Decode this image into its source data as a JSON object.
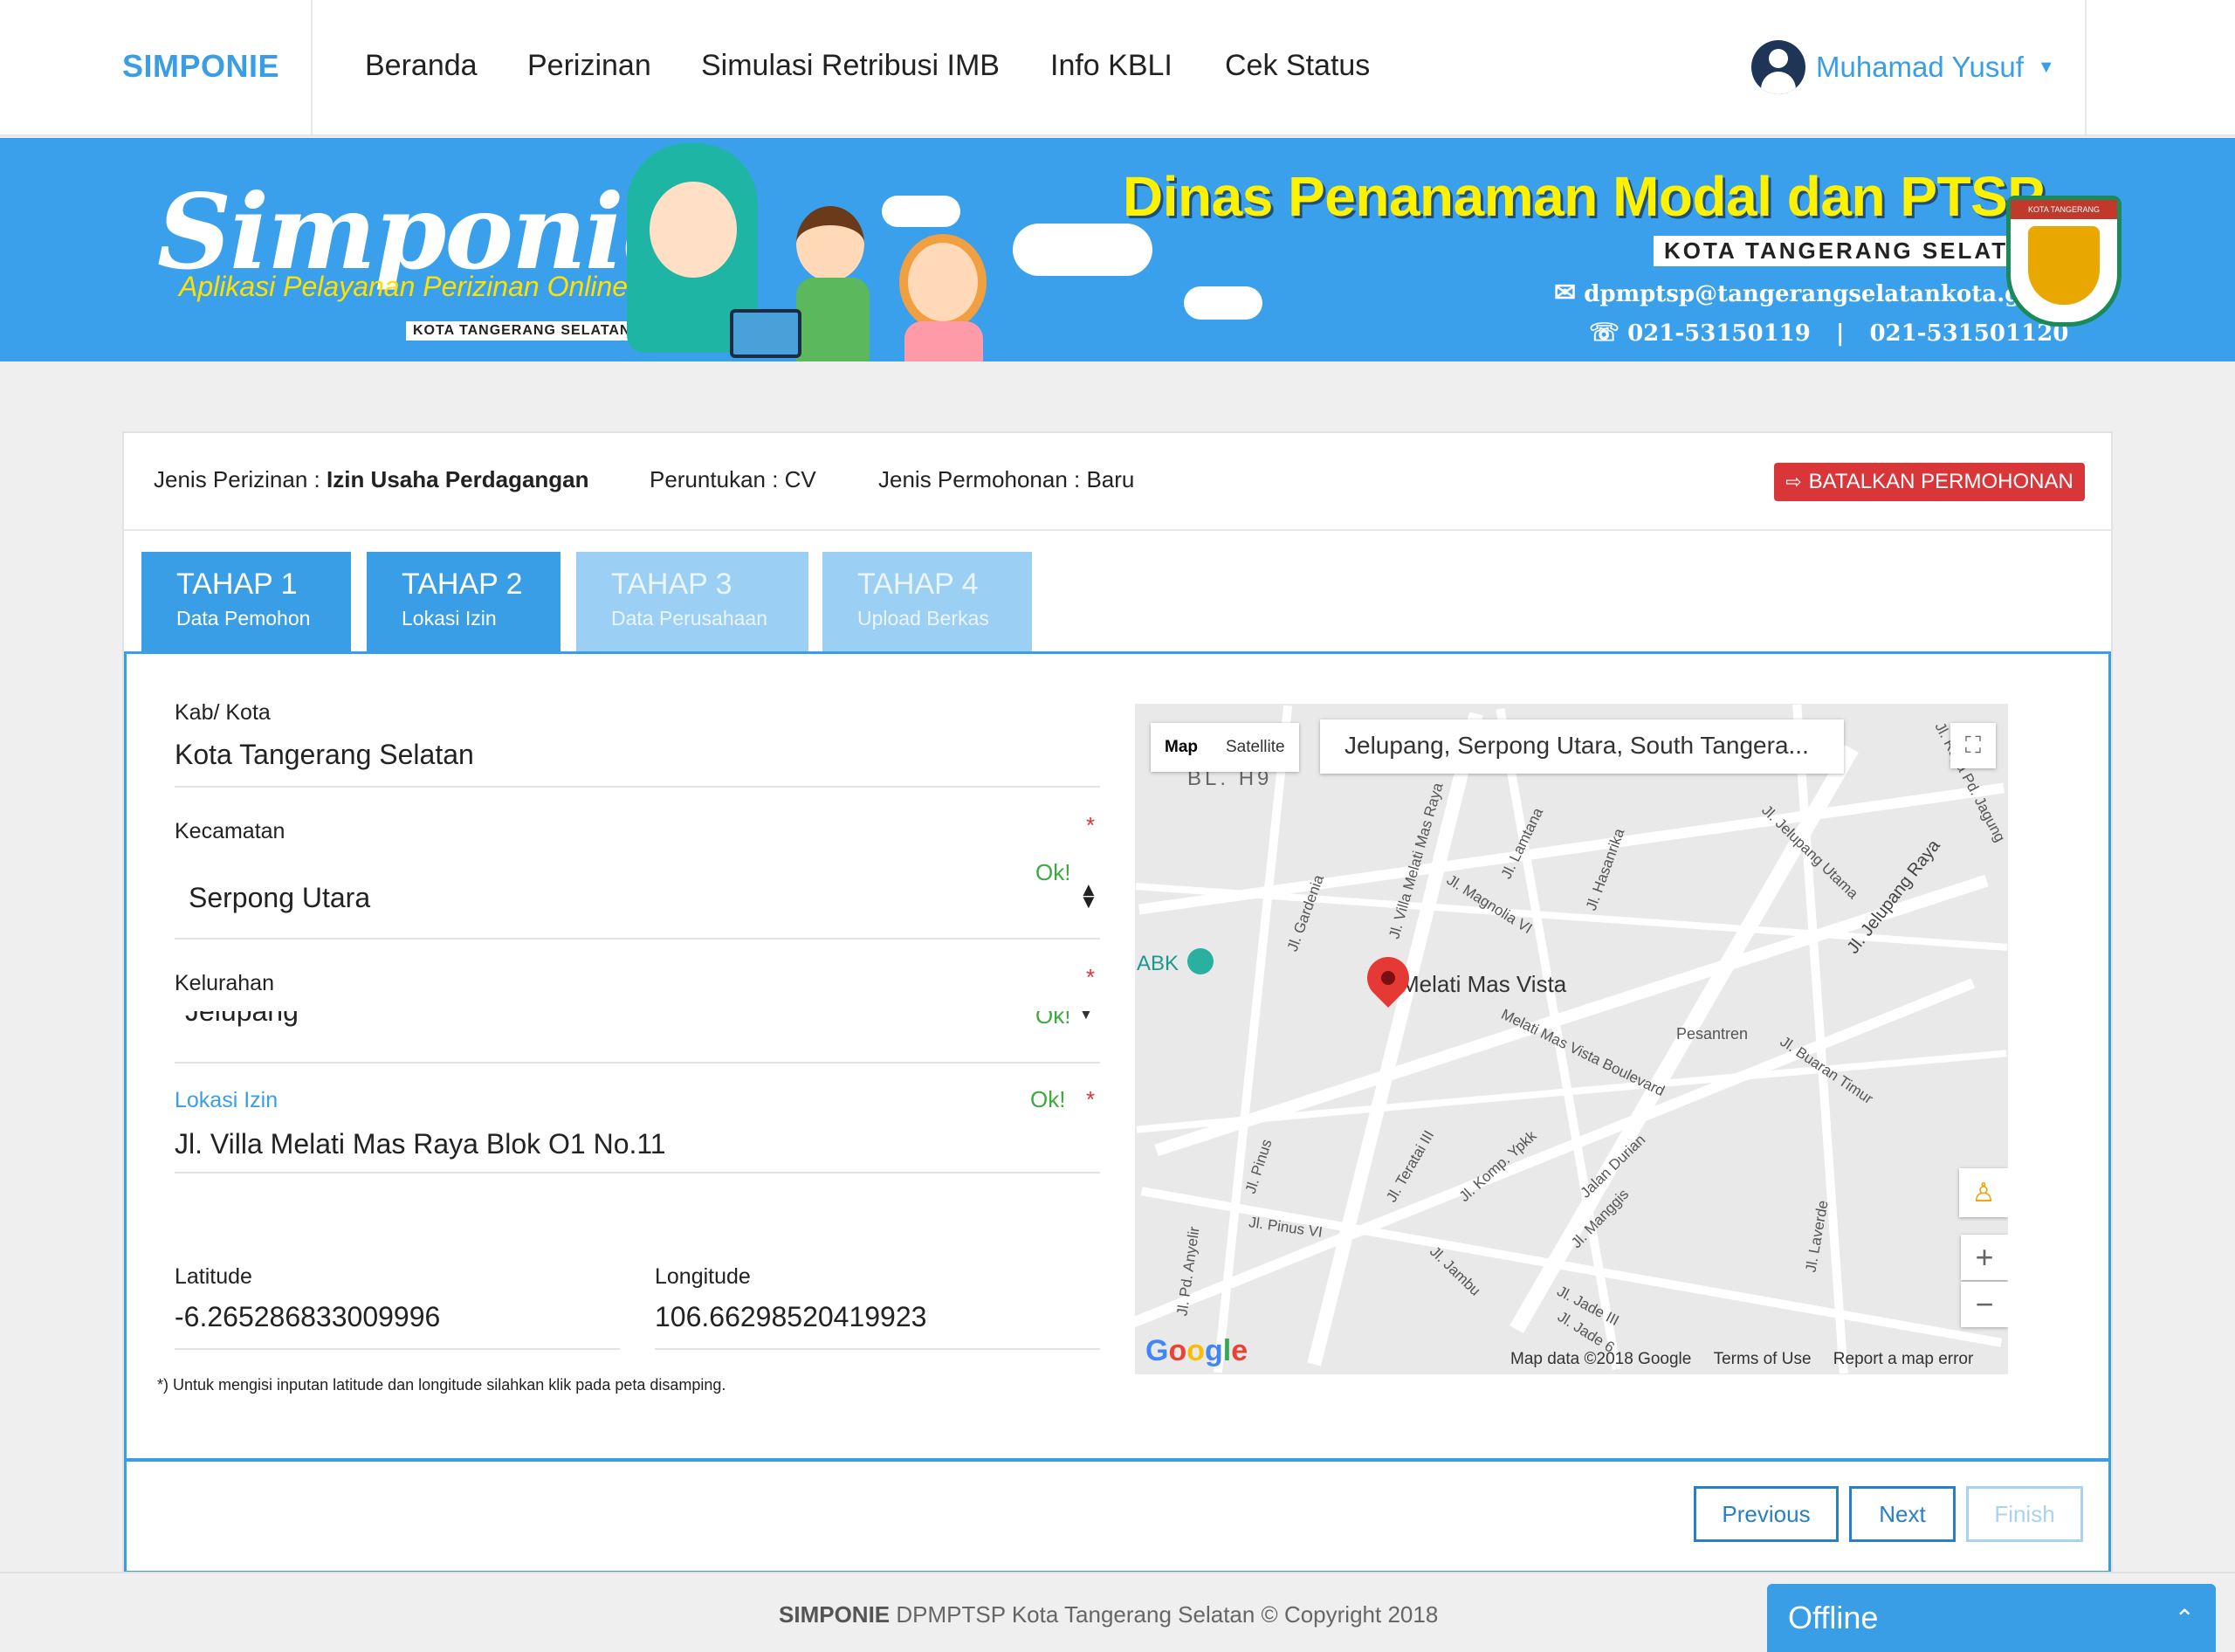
{
  "navbar": {
    "brand": "SIMPONIE",
    "items": [
      "Beranda",
      "Perizinan",
      "Simulasi Retribusi IMB",
      "Info KBLI",
      "Cek Status"
    ],
    "user_name": "Muhamad Yusuf"
  },
  "banner": {
    "title": "Simponie",
    "subtitle": "Aplikasi Pelayanan Perizinan Online",
    "small": "KOTA TANGERANG SELATAN",
    "dinas": "Dinas Penanaman Modal dan PTSP",
    "kota": "KOTA TANGERANG SELATAN",
    "email": "dpmptsp@tangerangselatankota.go.id",
    "phone1": "021-53150119",
    "phone_sep": "|",
    "phone2": "021-531501120",
    "emblem_text": "KOTA TANGERANG SELATAN"
  },
  "info": {
    "jenis_perizinan_label": "Jenis Perizinan :",
    "jenis_perizinan_value": "Izin Usaha Perdagangan",
    "peruntukan": "Peruntukan : CV",
    "jenis_permohonan": "Jenis Permohonan : Baru",
    "cancel_label": "BATALKAN PERMOHONAN"
  },
  "tabs": [
    {
      "title": "TAHAP 1",
      "sub": "Data Pemohon"
    },
    {
      "title": "TAHAP 2",
      "sub": "Lokasi Izin"
    },
    {
      "title": "TAHAP 3",
      "sub": "Data Perusahaan"
    },
    {
      "title": "TAHAP 4",
      "sub": "Upload Berkas"
    }
  ],
  "form": {
    "kab_label": "Kab/ Kota",
    "kab_value": "Kota Tangerang Selatan",
    "kec_label": "Kecamatan",
    "kec_value": "Serpong Utara",
    "kel_label": "Kelurahan",
    "kel_value": "Jelupang",
    "lokasi_label": "Lokasi Izin",
    "lokasi_value": "Jl. Villa Melati Mas Raya Blok O1 No.11",
    "lat_label": "Latitude",
    "lat_value": "-6.265286833009996",
    "lng_label": "Longitude",
    "lng_value": "106.66298520419923",
    "ok": "Ok!",
    "required": "*",
    "note": "*) Untuk mengisi inputan latitude dan longitude silahkan klik pada peta disamping."
  },
  "map": {
    "type_map": "Map",
    "type_satellite": "Satellite",
    "search": "Jelupang, Serpong Utara, South Tangera...",
    "place": "Melati Mas Vista",
    "poi": "ABK",
    "block": "BL. H9",
    "roads": [
      "Jl. Villa Melati Mas Raya",
      "Jl. Magnolia VI",
      "Jl. Lamtana",
      "Jl. Hasanrika",
      "Jl. Jelupang Utama",
      "Jl. Jelupang Raya",
      "Jl. Gardenia",
      "Melati Mas Vista Boulevard",
      "Jl. Buaran Timur",
      "Jl. Pinus",
      "Jl. Pinus VI",
      "Jl. Teratai III",
      "Jl. Komp. Ypkk",
      "Jalan Durian",
      "Jl. Manggis",
      "Jl. Jade III",
      "Jl. Jade 6",
      "Jl. Laverde",
      "Jl. Pd. Anyelir",
      "Jl. Jambu",
      "Pesantren",
      "Jl. Raya Pd. Jagung"
    ],
    "google": "Google",
    "footer_data": "Map data ©2018 Google",
    "footer_terms": "Terms of Use",
    "footer_report": "Report a map error"
  },
  "buttons": {
    "previous": "Previous",
    "next": "Next",
    "finish": "Finish"
  },
  "footer": {
    "brand": "SIMPONIE",
    "text": "DPMPTSP Kota Tangerang Selatan © Copyright 2018"
  },
  "chat": {
    "label": "Offline"
  }
}
